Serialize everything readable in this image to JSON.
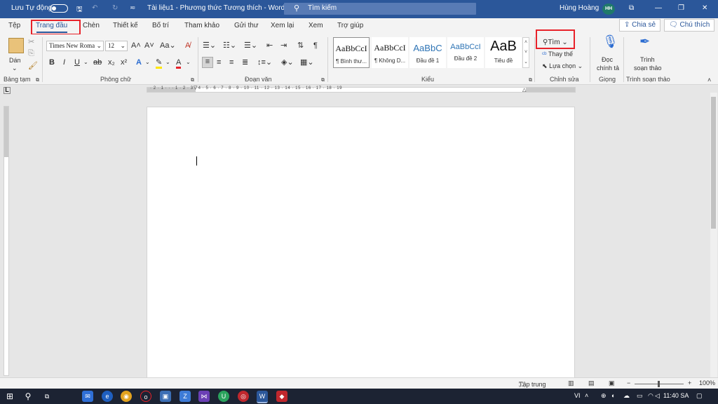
{
  "titlebar": {
    "autosave_label": "Lưu Tự động",
    "doc_title": "Tài liệu1  -  Phương thức Tương thích  -  Word",
    "search_placeholder": "Tìm kiếm",
    "user_name": "Hùng Hoàng",
    "user_initials": "HH",
    "qat_customize_icon": "≂"
  },
  "tabs": [
    "Tệp",
    "Trang đầu",
    "Chèn",
    "Thiết kế",
    "Bố trí",
    "Tham khảo",
    "Gửi thư",
    "Xem lại",
    "Xem",
    "Trợ giúp"
  ],
  "share_label": "Chia sẻ",
  "comments_label": "Chú thích",
  "ribbon": {
    "clipboard": {
      "paste": "Dán",
      "group": "Bảng tạm"
    },
    "font": {
      "name": "Times New Roma",
      "size": "12",
      "group": "Phông chữ"
    },
    "paragraph": {
      "group": "Đoạn văn"
    },
    "styles": {
      "group": "Kiểu",
      "items": [
        {
          "sample": "AaBbCcI",
          "name": "¶ Bình thư..."
        },
        {
          "sample": "AaBbCcI",
          "name": "¶ Không D..."
        },
        {
          "sample": "AaBbC",
          "name": "Đầu đề 1"
        },
        {
          "sample": "AaBbCcI",
          "name": "Đầu đề 2"
        },
        {
          "sample": "AaB",
          "name": "Tiêu đề"
        }
      ]
    },
    "editing": {
      "find": "Tìm",
      "replace": "Thay thế",
      "select": "Lựa chọn",
      "group": "Chỉnh sửa"
    },
    "voice": {
      "dictate_1": "Đọc",
      "dictate_2": "chính tả",
      "group": "Giọng"
    },
    "editor": {
      "label_1": "Trình",
      "label_2": "soạn thảo",
      "group": "Trình soạn thảo"
    }
  },
  "ruler_labels": "· 2 · 1 · · · 1 · 2 · 3 · 4 · 5 · 6 · 7 · 8 · 9 · 10 · 11 · 12 · 13 · 14 · 15 · 16 · 17 · 18 · 19",
  "statusbar": {
    "focus": "Tập trung",
    "zoom": "100%",
    "zoom_minus": "−",
    "zoom_plus": "+"
  },
  "taskbar": {
    "lang": "VI",
    "time": "11:40 SA"
  },
  "colors": {
    "word_blue": "#2b579a",
    "highlight_red": "#e8222a",
    "taskbar": "#1c2333"
  }
}
